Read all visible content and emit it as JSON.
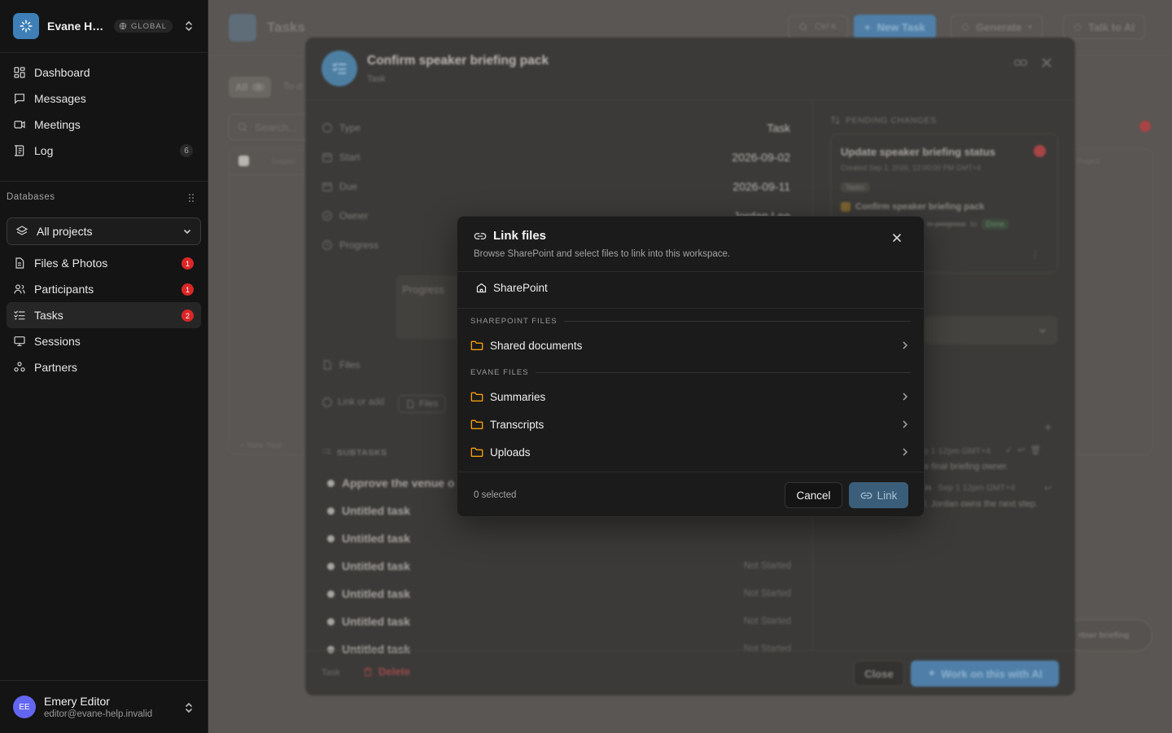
{
  "colors": {
    "accent": "#3e7fb8",
    "danger": "#dc2626",
    "folder": "#f59e0b",
    "success": "#16a34a",
    "link_button": "#3a5e7a"
  },
  "workspace": {
    "name": "Evane Help Center",
    "scope_badge": "GLOBAL"
  },
  "sidebar": {
    "nav": [
      {
        "label": "Dashboard",
        "icon": "dashboard-icon"
      },
      {
        "label": "Messages",
        "icon": "message-icon"
      },
      {
        "label": "Meetings",
        "icon": "video-icon"
      },
      {
        "label": "Log",
        "icon": "log-icon",
        "count": "6"
      }
    ],
    "databases_label": "Databases",
    "project_select": "All projects",
    "db_items": [
      {
        "label": "Files & Photos",
        "icon": "file-icon",
        "badge": "1"
      },
      {
        "label": "Participants",
        "icon": "users-icon",
        "badge": "1"
      },
      {
        "label": "Tasks",
        "icon": "tasks-icon",
        "badge": "2",
        "active": true
      },
      {
        "label": "Sessions",
        "icon": "monitor-icon"
      },
      {
        "label": "Partners",
        "icon": "partners-icon"
      }
    ],
    "user": {
      "initials": "EE",
      "name": "Emery Editor",
      "email": "editor@evane-help.invalid"
    }
  },
  "background": {
    "page_title": "Tasks",
    "search_hint": "Ctrl K",
    "new_task": "New Task",
    "generate": "Generate",
    "talk_to_ai": "Talk to AI",
    "filter_all": "All",
    "filter_all_count": "9",
    "filter_todo": "To-d",
    "search_placeholder": "Search...",
    "column_subject": "Subject",
    "column_project": "Project",
    "new_task_row": "New Task",
    "detail": {
      "title": "Confirm speaker briefing pack",
      "kind": "Task",
      "fields": [
        {
          "label": "Type",
          "value": "Task",
          "icon": "type-icon"
        },
        {
          "label": "Start",
          "value": "2026-09-02",
          "icon": "calendar-icon"
        },
        {
          "label": "Due",
          "value": "2026-09-11",
          "icon": "calendar-icon"
        },
        {
          "label": "Owner",
          "value": "Jordan Lee",
          "icon": "owner-icon"
        },
        {
          "label": "Progress",
          "value": "",
          "icon": "progress-icon"
        }
      ],
      "progress_placeholder": "Progress",
      "files_label": "Files",
      "link_or_add": "Link or add",
      "files_button": "Files",
      "subtasks_label": "SUBTASKS",
      "subtasks": [
        {
          "title": "Approve the venue o",
          "status": ""
        },
        {
          "title": "Untitled task",
          "status": ""
        },
        {
          "title": "Untitled task",
          "status": ""
        },
        {
          "title": "Untitled task",
          "status": "Not Started"
        },
        {
          "title": "Untitled task",
          "status": "Not Started"
        },
        {
          "title": "Untitled task",
          "status": "Not Started"
        },
        {
          "title": "Untitled task",
          "status": "Not Started"
        }
      ],
      "pending_label": "PENDING CHANGES",
      "pending_title": "Update speaker briefing status",
      "pending_created": "Created Sep 1, 2026, 12:00:00 PM GMT+4",
      "pending_tag": "Tasks",
      "pending_item": "Confirm speaker briefing pack",
      "pending_from": "in-progress",
      "pending_to_word": "to",
      "pending_to": "Done",
      "comment1_time": "p 1 12pm GMT+4",
      "comment1_text": "e final briefing owner.",
      "comment2_author": "in",
      "comment2_time": "Sep 1 12pm GMT+4",
      "comment2_text": "l. Jordan owns the next step.",
      "floating_hint": "rtner briefing",
      "footer_kind": "Task",
      "delete": "Delete",
      "close": "Close",
      "work_with_ai": "Work on this with AI"
    }
  },
  "modal": {
    "title": "Link files",
    "description": "Browse SharePoint and select files to link into this workspace.",
    "breadcrumb": "SharePoint",
    "sections": [
      {
        "label": "SHAREPOINT FILES",
        "folders": [
          "Shared documents"
        ]
      },
      {
        "label": "EVANE FILES",
        "folders": [
          "Summaries",
          "Transcripts",
          "Uploads"
        ]
      }
    ],
    "selected_count": "0 selected",
    "cancel": "Cancel",
    "link": "Link"
  }
}
